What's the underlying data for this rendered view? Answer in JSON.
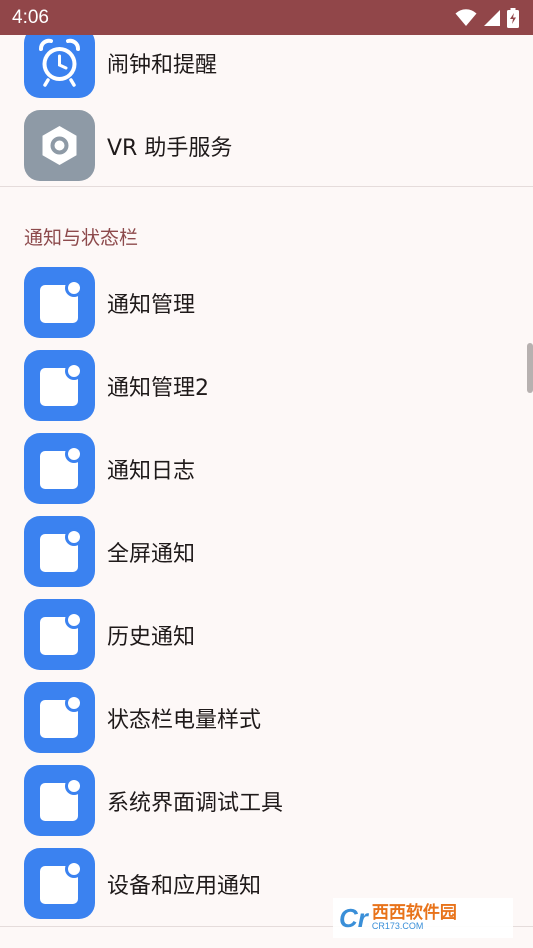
{
  "status_bar": {
    "time": "4:06",
    "icons": [
      "wifi-icon",
      "cellular-signal-icon",
      "battery-charging-icon"
    ],
    "background": "#914649"
  },
  "list": {
    "top_items": [
      {
        "label": "闹钟和提醒",
        "icon": "alarm-clock-icon"
      },
      {
        "label": "VR 助手服务",
        "icon": "vr-settings-icon"
      }
    ],
    "section_title": "通知与状态栏",
    "section_items": [
      {
        "label": "通知管理",
        "icon": "notification-icon"
      },
      {
        "label": "通知管理2",
        "icon": "notification-icon"
      },
      {
        "label": "通知日志",
        "icon": "notification-icon"
      },
      {
        "label": "全屏通知",
        "icon": "notification-icon"
      },
      {
        "label": "历史通知",
        "icon": "notification-icon"
      },
      {
        "label": "状态栏电量样式",
        "icon": "notification-icon"
      },
      {
        "label": "系统界面调试工具",
        "icon": "notification-icon"
      },
      {
        "label": "设备和应用通知",
        "icon": "notification-icon"
      }
    ]
  },
  "colors": {
    "accent_blue": "#3b82f0",
    "gray_icon": "#8e9aa6",
    "section_title": "#8d4a4c",
    "background": "#fdf8f7"
  },
  "watermark": {
    "main": "西西软件园",
    "sub": "CR173.COM"
  }
}
